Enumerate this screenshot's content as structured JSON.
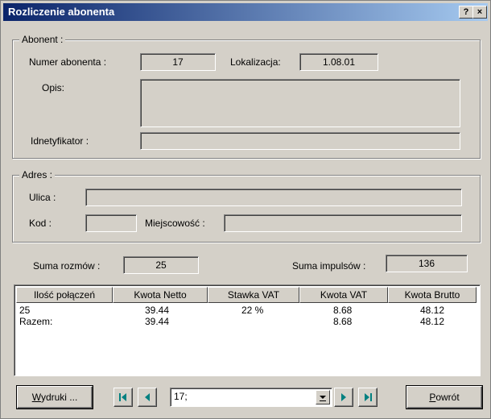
{
  "window": {
    "title": "Rozliczenie abonenta",
    "help_glyph": "?",
    "close_glyph": "×"
  },
  "abonent": {
    "legend": "Abonent :",
    "numer_label": "Numer abonenta :",
    "numer_value": "17",
    "lokalizacja_label": "Lokalizacja:",
    "lokalizacja_value": "1.08.01",
    "opis_label": "Opis:",
    "opis_value": "",
    "identyfikator_label": "Idnetyfikator :",
    "identyfikator_value": ""
  },
  "adres": {
    "legend": "Adres :",
    "ulica_label": "Ulica :",
    "ulica_value": "",
    "kod_label": "Kod :",
    "kod_value": "",
    "miejscowosc_label": "Miejscowość :",
    "miejscowosc_value": ""
  },
  "sumy": {
    "rozmow_label": "Suma rozmów :",
    "rozmow_value": "25",
    "impulsow_label": "Suma impulsów :",
    "impulsow_value": "136"
  },
  "table": {
    "headers": [
      "Ilość połączeń",
      "Kwota Netto",
      "Stawka VAT",
      "Kwota VAT",
      "Kwota Brutto"
    ],
    "rows": [
      [
        "25",
        "39.44",
        "22 %",
        "8.68",
        "48.12"
      ],
      [
        "Razem:",
        "39.44",
        "",
        "8.68",
        "48.12"
      ]
    ]
  },
  "footer": {
    "wydruki_pre": "W",
    "wydruki_rest": "ydruki ...",
    "record_value": "17;",
    "powrot_pre": "P",
    "powrot_rest": "owrót"
  },
  "colors": {
    "titlebar_start": "#0a246a",
    "titlebar_end": "#a6caf0",
    "face": "#d4d0c8",
    "nav_arrow": "#008080"
  },
  "icons": [
    "help-icon",
    "close-icon",
    "first-record-icon",
    "prev-record-icon",
    "dropdown-arrow-icon",
    "next-record-icon",
    "last-record-icon"
  ]
}
